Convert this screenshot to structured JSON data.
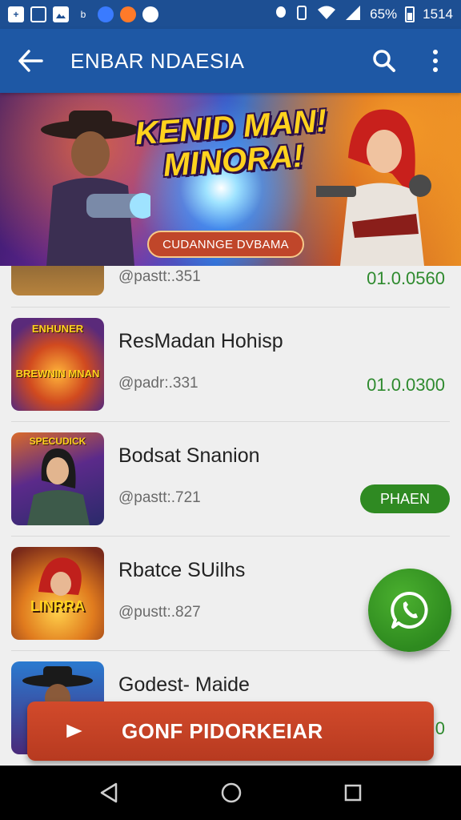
{
  "status_bar": {
    "battery_text": "65%",
    "time": "1514",
    "left_icons": [
      "plus-icon",
      "keyboard-icon",
      "image-icon",
      "b-icon",
      "blue-app-icon",
      "orange-app-icon",
      "ball-icon"
    ],
    "right_icons": [
      "dot-icon",
      "notification-icon",
      "vibrate-icon",
      "wifi-icon",
      "signal-icon",
      "battery-icon"
    ]
  },
  "app_bar": {
    "title": "ENBAR NDAESIA",
    "icons": [
      "back-arrow-icon",
      "search-icon",
      "more-vertical-icon"
    ]
  },
  "banner": {
    "title_line1": "KENID MAN!",
    "title_line2": "MINORA!",
    "badge": "CUDANNGE DVBAMA"
  },
  "list": {
    "items": [
      {
        "name": "",
        "meta": "@pastt:.351",
        "version": "01.0.0560"
      },
      {
        "name": "ResMadan Hohisp",
        "meta": "@padr:.331",
        "version": "01.0.0300",
        "thumb_text_top": "ENHUNER",
        "thumb_text_bottom": "BREWNIN MNAN"
      },
      {
        "name": "Bodsat Snanion",
        "meta": "@pastt:.721",
        "action": "PHAEN",
        "thumb_text_top": "SPECUDICK"
      },
      {
        "name": "Rbatce SUilhs",
        "meta": "@pustt:.827",
        "thumb_text_top": "LINRRA"
      },
      {
        "name": "Godest- Maide",
        "meta": "",
        "version": "0"
      }
    ]
  },
  "fab": {
    "icon": "whatsapp-icon"
  },
  "cta": {
    "label": "GONF PIDORKEIAR",
    "icon": "play-icon"
  },
  "nav_bar": {
    "icons": [
      "back-triangle-icon",
      "home-circle-icon",
      "recents-square-icon"
    ]
  },
  "colors": {
    "primary": "#1e58a5",
    "green": "#2e8a1f",
    "cta": "#c4432a"
  }
}
